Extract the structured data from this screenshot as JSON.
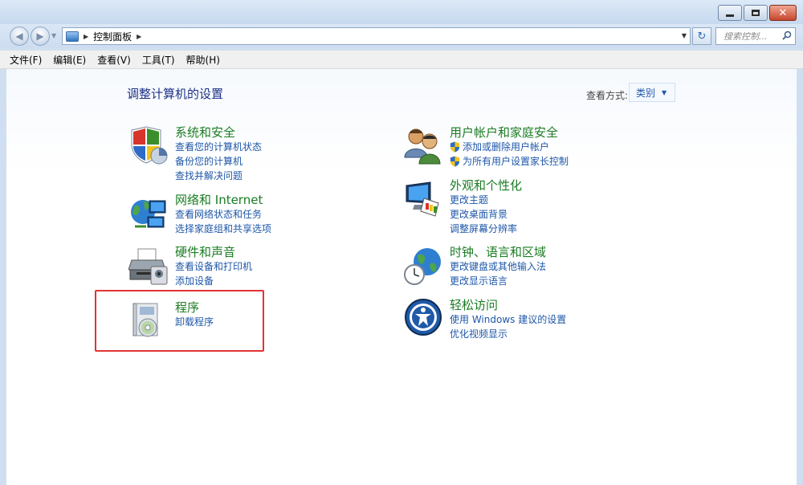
{
  "window": {
    "controls": {
      "minimize": "–",
      "maximize": "□",
      "close": "✕"
    }
  },
  "navigation": {
    "back_icon": "back-arrow-icon",
    "forward_icon": "forward-arrow-icon",
    "address": "控制面板",
    "search_placeholder": "搜索控制..."
  },
  "menu": [
    "文件(F)",
    "编辑(E)",
    "查看(V)",
    "工具(T)",
    "帮助(H)"
  ],
  "page": {
    "title": "调整计算机的设置",
    "view_by_label": "查看方式:",
    "view_by_value": "类别"
  },
  "categories_left": [
    {
      "title": "系统和安全",
      "icon": "shield-icon",
      "links": [
        "查看您的计算机状态",
        "备份您的计算机",
        "查找并解决问题"
      ]
    },
    {
      "title": "网络和 Internet",
      "icon": "network-globe-icon",
      "links": [
        "查看网络状态和任务",
        "选择家庭组和共享选项"
      ]
    },
    {
      "title": "硬件和声音",
      "icon": "printer-icon",
      "links": [
        "查看设备和打印机",
        "添加设备"
      ]
    },
    {
      "title": "程序",
      "icon": "programs-disc-icon",
      "links": [
        "卸载程序"
      ]
    }
  ],
  "categories_right": [
    {
      "title": "用户帐户和家庭安全",
      "icon": "users-icon",
      "links": [
        "添加或删除用户帐户",
        "为所有用户设置家长控制"
      ]
    },
    {
      "title": "外观和个性化",
      "icon": "monitor-palette-icon",
      "links": [
        "更改主题",
        "更改桌面背景",
        "调整屏幕分辨率"
      ]
    },
    {
      "title": "时钟、语言和区域",
      "icon": "clock-globe-icon",
      "links": [
        "更改键盘或其他输入法",
        "更改显示语言"
      ]
    },
    {
      "title": "轻松访问",
      "icon": "ease-of-access-icon",
      "links": [
        "使用 Windows 建议的设置",
        "优化视频显示"
      ]
    }
  ],
  "colors": {
    "category_title": "#1b7c23",
    "link": "#1e57a8",
    "highlight_box": "#e23333"
  }
}
